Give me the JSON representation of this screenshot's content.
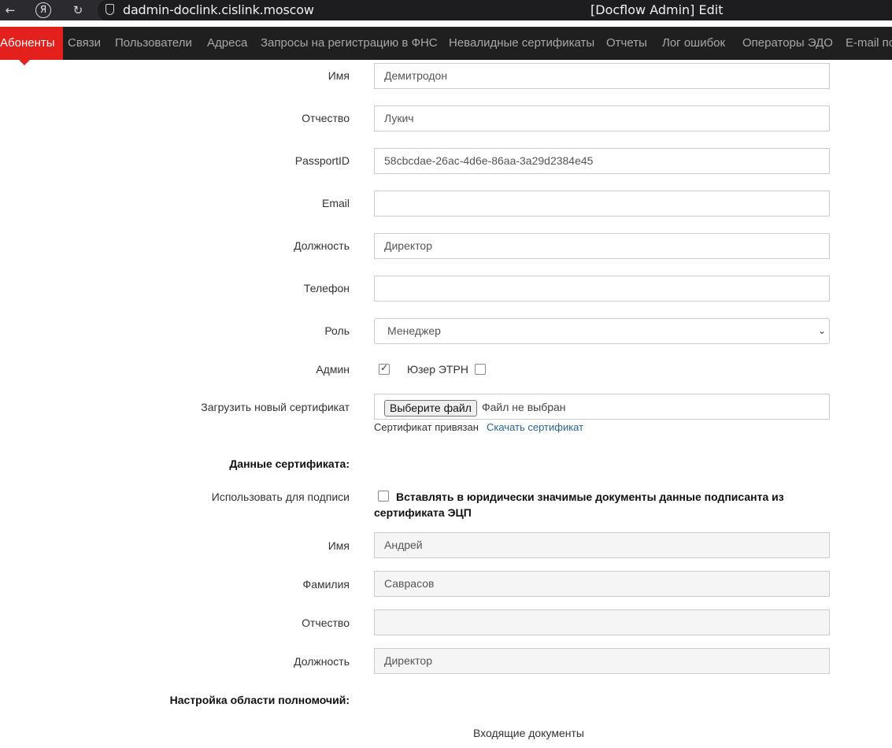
{
  "browser": {
    "back_icon": "back-arrow-icon",
    "yandex_logo": "Я",
    "reload_icon": "reload-icon",
    "url": "dadmin-doclink.cislink.moscow",
    "tab_title": "[Docflow Admin] Edit"
  },
  "nav": {
    "items": [
      {
        "label": "Абоненты"
      },
      {
        "label": "Связи"
      },
      {
        "label": "Пользователи"
      },
      {
        "label": "Адреса"
      },
      {
        "label": "Запросы на регистрацию в ФНС"
      },
      {
        "label": "Невалидные сертификаты"
      },
      {
        "label": "Отчеты"
      },
      {
        "label": "Лог ошибок"
      },
      {
        "label": "Операторы ЭДО"
      },
      {
        "label": "E-mail по"
      }
    ],
    "accent_color": "#e3201c"
  },
  "form": {
    "first_name": {
      "label": "Имя",
      "value": "Демитродон"
    },
    "patronymic": {
      "label": "Отчество",
      "value": "Лукич"
    },
    "passport_id": {
      "label": "PassportID",
      "value": "58cbcdae-26ac-4d6e-86aa-3a29d2384e45"
    },
    "email": {
      "label": "Email",
      "value": ""
    },
    "position": {
      "label": "Должность",
      "value": "Директор"
    },
    "phone": {
      "label": "Телефон",
      "value": ""
    },
    "role": {
      "label": "Роль",
      "value": "Менеджер"
    },
    "admin": {
      "label": "Админ",
      "checked": true
    },
    "etrn_user": {
      "label": "Юзер ЭТРН",
      "checked": false
    },
    "certificate": {
      "label": "Загрузить новый сертификат",
      "button": "Выберите файл",
      "status": "Файл не выбран",
      "attached_text": "Сертификат привязан",
      "download_link": "Скачать сертификат"
    }
  },
  "cert_data": {
    "heading": "Данные сертификата:",
    "use_for_sign": {
      "label": "Использовать для подписи",
      "checked": false,
      "text_line1": "Вставлять в юридически значимые документы данные подписанта из",
      "text_line2": "сертификата ЭЦП"
    },
    "first_name": {
      "label": "Имя",
      "value": "Андрей"
    },
    "last_name": {
      "label": "Фамилия",
      "value": "Саврасов"
    },
    "patronymic": {
      "label": "Отчество",
      "value": ""
    },
    "position": {
      "label": "Должность",
      "value": "Директор"
    }
  },
  "authority": {
    "heading": "Настройка области полномочий:",
    "incoming_docs": "Входящие документы"
  }
}
